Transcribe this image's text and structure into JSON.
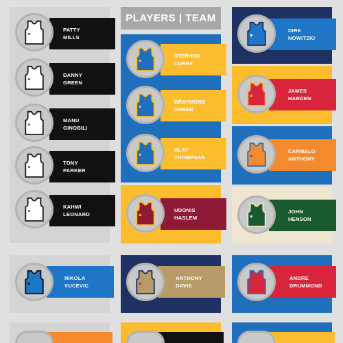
{
  "header": {
    "title": "PLAYERS | TEAM"
  },
  "left_players": [
    {
      "line1": "PATTY",
      "line2": "MILLS"
    },
    {
      "line1": "DANNY",
      "line2": "GREEN"
    },
    {
      "line1": "MANU",
      "line2": "GINOBILI"
    },
    {
      "line1": "TONY",
      "line2": "PARKER"
    },
    {
      "line1": "KAHWI",
      "line2": "LEONARD"
    }
  ],
  "center_players": [
    {
      "line1": "STEPHEN",
      "line2": "CURRY"
    },
    {
      "line1": "DRAYMOND",
      "line2": "GREEN"
    },
    {
      "line1": "KLAY",
      "line2": "THOMPSAN"
    },
    {
      "line1": "UDONIS",
      "line2": "HASLEM"
    }
  ],
  "right_players": [
    {
      "line1": "DIRK",
      "line2": "NOWITZKI"
    },
    {
      "line1": "JAMES",
      "line2": "HARDEN"
    },
    {
      "line1": "CARMELO",
      "line2": "ANTHONY"
    },
    {
      "line1": "JOHN",
      "line2": "HENSON"
    }
  ],
  "bottom_players": [
    {
      "line1": "NIKOLA",
      "line2": "VUCEVIC"
    },
    {
      "line1": "ANTHONY",
      "line2": "DAVIS"
    },
    {
      "line1": "ANDRE",
      "line2": "DRUMMOND"
    }
  ],
  "colors": {
    "background": "#e0e0e0",
    "spurs_black": "#111111",
    "warriors_blue": "#1f6fbd",
    "warriors_gold": "#fbbd2e",
    "mavs_navy": "#1d3263",
    "mavs_blue": "#1f75c6",
    "heat_red": "#8e1a36",
    "rockets_red": "#d8253c",
    "knicks_orange": "#f5892e",
    "bucks_green": "#1a5a2f",
    "bucks_cream": "#efe6cf",
    "pelicans_gold": "#b79b68"
  }
}
